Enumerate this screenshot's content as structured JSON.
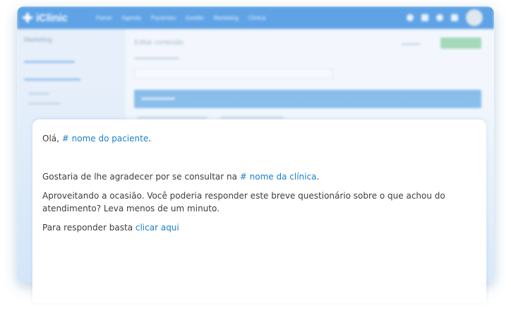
{
  "app": {
    "logo_text": "iClinic",
    "nav": [
      "Painel",
      "Agenda",
      "Pacientes",
      "Gestão",
      "Marketing",
      "Clínica"
    ],
    "sidebar_title": "Marketing",
    "content_title": "Editar conteúdo"
  },
  "message": {
    "greeting_prefix": "Olá, ",
    "patient_var": "# nome do paciente",
    "greeting_suffix": ".",
    "thanks_prefix": "Gostaria de lhe agradecer por se consultar na ",
    "clinic_var": "# nome da clínica",
    "thanks_suffix": ".",
    "survey_line1": "Aproveitando a ocasião. Você poderia responder este breve questionário sobre o que achou do",
    "survey_line2": "atendimento? Leva menos de um minuto.",
    "cta_prefix": "Para responder basta ",
    "cta_link": "clicar aqui"
  },
  "colors": {
    "accent": "#1b7fc8",
    "topbar": "#4f9be4",
    "text": "#3d3d3d"
  }
}
